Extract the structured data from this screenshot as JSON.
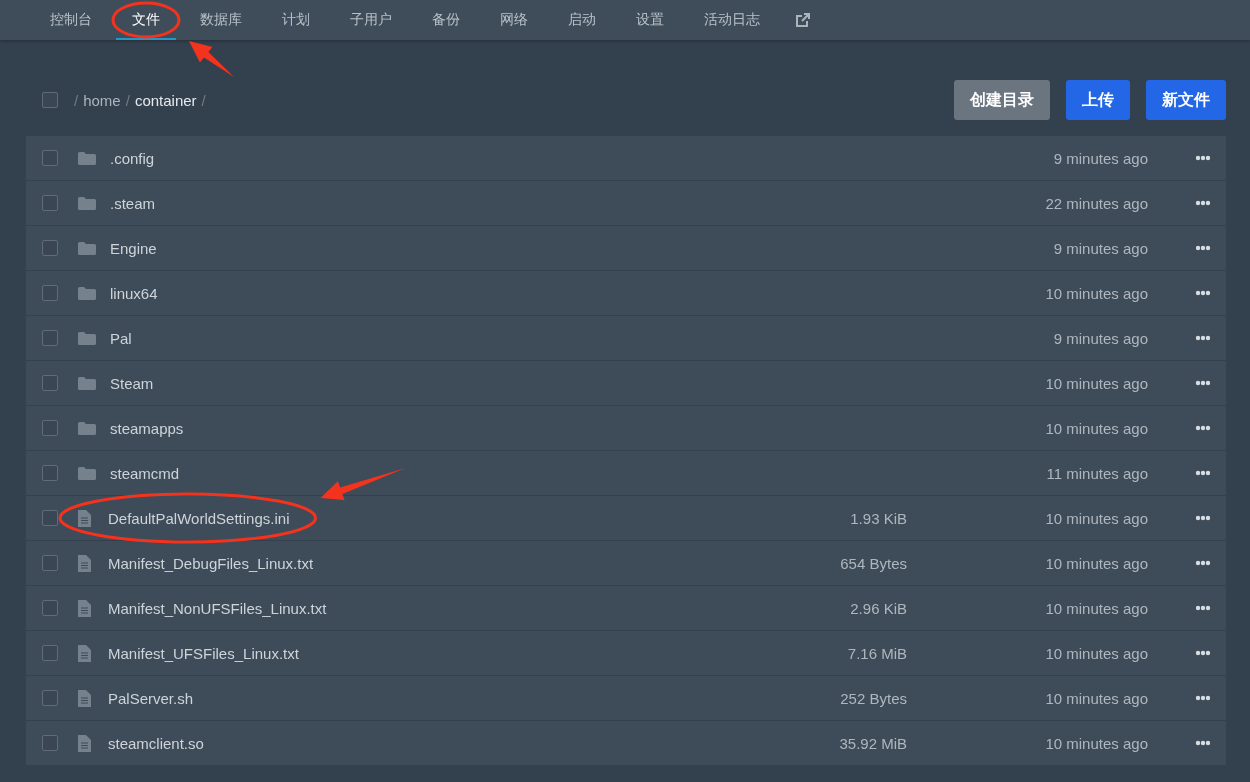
{
  "nav": {
    "tabs": [
      {
        "label": "控制台",
        "selected": false,
        "highlighted": false
      },
      {
        "label": "文件",
        "selected": true,
        "highlighted": true
      },
      {
        "label": "数据库",
        "selected": false,
        "highlighted": false
      },
      {
        "label": "计划",
        "selected": false,
        "highlighted": false
      },
      {
        "label": "子用户",
        "selected": false,
        "highlighted": false
      },
      {
        "label": "备份",
        "selected": false,
        "highlighted": false
      },
      {
        "label": "网络",
        "selected": false,
        "highlighted": false
      },
      {
        "label": "启动",
        "selected": false,
        "highlighted": false
      },
      {
        "label": "设置",
        "selected": false,
        "highlighted": false
      },
      {
        "label": "活动日志",
        "selected": false,
        "highlighted": false
      }
    ]
  },
  "toolbar": {
    "select_all_checked": false,
    "breadcrumb": [
      {
        "label": "home",
        "current": false
      },
      {
        "label": "container",
        "current": true
      }
    ],
    "separator": "/",
    "buttons": [
      {
        "label": "创建目录",
        "kind": "secondary"
      },
      {
        "label": "上传",
        "kind": "primary"
      },
      {
        "label": "新文件",
        "kind": "primary"
      }
    ]
  },
  "files": [
    {
      "kind": "folder",
      "name": ".config",
      "modified": "9 minutes ago",
      "checked": false,
      "highlighted": false
    },
    {
      "kind": "folder",
      "name": ".steam",
      "modified": "22 minutes ago",
      "checked": false,
      "highlighted": false
    },
    {
      "kind": "folder",
      "name": "Engine",
      "modified": "9 minutes ago",
      "checked": false,
      "highlighted": false
    },
    {
      "kind": "folder",
      "name": "linux64",
      "modified": "10 minutes ago",
      "checked": false,
      "highlighted": false
    },
    {
      "kind": "folder",
      "name": "Pal",
      "modified": "9 minutes ago",
      "checked": false,
      "highlighted": false
    },
    {
      "kind": "folder",
      "name": "Steam",
      "modified": "10 minutes ago",
      "checked": false,
      "highlighted": false
    },
    {
      "kind": "folder",
      "name": "steamapps",
      "modified": "10 minutes ago",
      "checked": false,
      "highlighted": false
    },
    {
      "kind": "folder",
      "name": "steamcmd",
      "modified": "11 minutes ago",
      "checked": false,
      "highlighted": false
    },
    {
      "kind": "file",
      "name": "DefaultPalWorldSettings.ini",
      "size": "1.93 KiB",
      "modified": "10 minutes ago",
      "checked": false,
      "highlighted": true
    },
    {
      "kind": "file",
      "name": "Manifest_DebugFiles_Linux.txt",
      "size": "654 Bytes",
      "modified": "10 minutes ago",
      "checked": false,
      "highlighted": false
    },
    {
      "kind": "file",
      "name": "Manifest_NonUFSFiles_Linux.txt",
      "size": "2.96 KiB",
      "modified": "10 minutes ago",
      "checked": false,
      "highlighted": false
    },
    {
      "kind": "file",
      "name": "Manifest_UFSFiles_Linux.txt",
      "size": "7.16 MiB",
      "modified": "10 minutes ago",
      "checked": false,
      "highlighted": false
    },
    {
      "kind": "file",
      "name": "PalServer.sh",
      "size": "252 Bytes",
      "modified": "10 minutes ago",
      "checked": false,
      "highlighted": false
    },
    {
      "kind": "file",
      "name": "steamclient.so",
      "size": "35.92 MiB",
      "modified": "10 minutes ago",
      "checked": false,
      "highlighted": false
    }
  ]
}
